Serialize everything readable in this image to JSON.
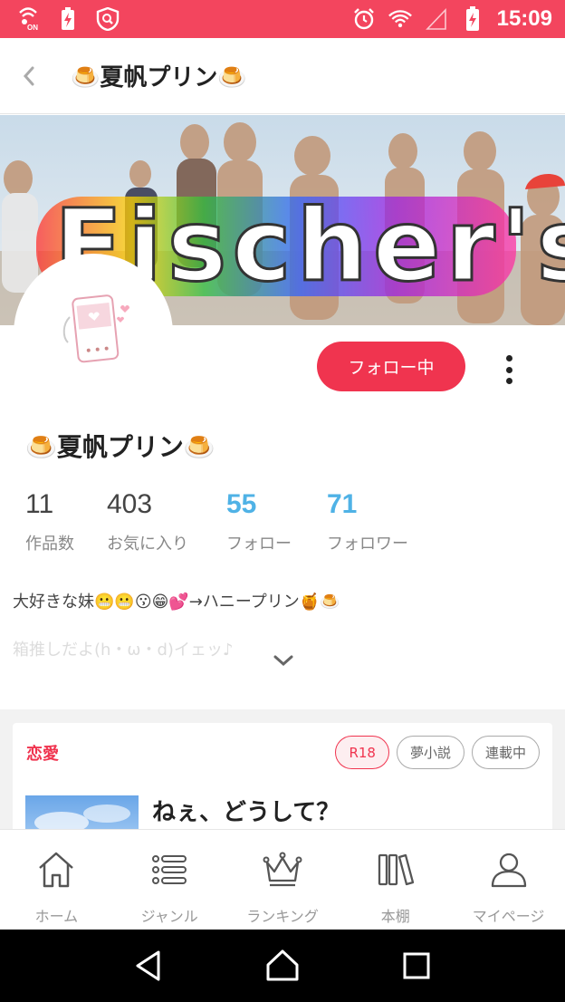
{
  "status_bar": {
    "time": "15:09",
    "icons": [
      "volte-icon",
      "battery-saver-icon",
      "shield-icon",
      "alarm-icon",
      "wifi-icon",
      "signal-icon",
      "battery-charging-icon"
    ]
  },
  "header": {
    "title": "🍮夏帆プリン🍮"
  },
  "profile": {
    "name": "🍮夏帆プリン🍮",
    "follow_label": "フォロー中",
    "stats": [
      {
        "value": "11",
        "label": "作品数"
      },
      {
        "value": "403",
        "label": "お気に入り"
      },
      {
        "value": "55",
        "label": "フォロー"
      },
      {
        "value": "71",
        "label": "フォロワー"
      }
    ],
    "bio_line1": "大好きな妹😬😬😗😁💕→ハニープリン🍯🍮",
    "bio_line2": "箱推しだよ(h・ω・d)イェッ♪"
  },
  "work_card": {
    "genre": "恋愛",
    "tags": [
      "R18",
      "夢小説",
      "連載中"
    ],
    "title": "ねぇ、どうして？"
  },
  "bottom_nav": [
    {
      "label": "ホーム",
      "icon": "home-icon"
    },
    {
      "label": "ジャンル",
      "icon": "list-icon"
    },
    {
      "label": "ランキング",
      "icon": "crown-icon"
    },
    {
      "label": "本棚",
      "icon": "bookshelf-icon"
    },
    {
      "label": "マイページ",
      "icon": "person-icon"
    }
  ],
  "colors": {
    "accent": "#f3455e",
    "follow_button": "#f0344f",
    "stat_blue": "#4fb2e6"
  }
}
